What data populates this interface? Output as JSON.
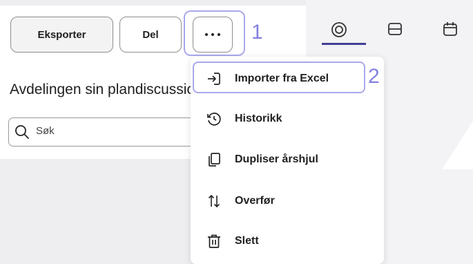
{
  "toolbar": {
    "export_label": "Eksporter",
    "share_label": "Del"
  },
  "page": {
    "title": "Avdelingen sin plandiscussion",
    "search_placeholder": "Søk"
  },
  "annotations": {
    "step1": "1",
    "step2": "2",
    "color": "#a9a8ea"
  },
  "view_tabs": [
    {
      "icon": "target-icon",
      "active": true
    },
    {
      "icon": "layout-rows-icon",
      "active": false
    },
    {
      "icon": "calendar-icon",
      "active": false
    }
  ],
  "menu": {
    "items": [
      {
        "label": "Importer fra Excel",
        "icon": "import-icon"
      },
      {
        "label": "Historikk",
        "icon": "history-icon"
      },
      {
        "label": "Dupliser årshjul",
        "icon": "duplicate-icon"
      },
      {
        "label": "Overfør",
        "icon": "transfer-icon"
      },
      {
        "label": "Slett",
        "icon": "trash-icon"
      }
    ]
  }
}
